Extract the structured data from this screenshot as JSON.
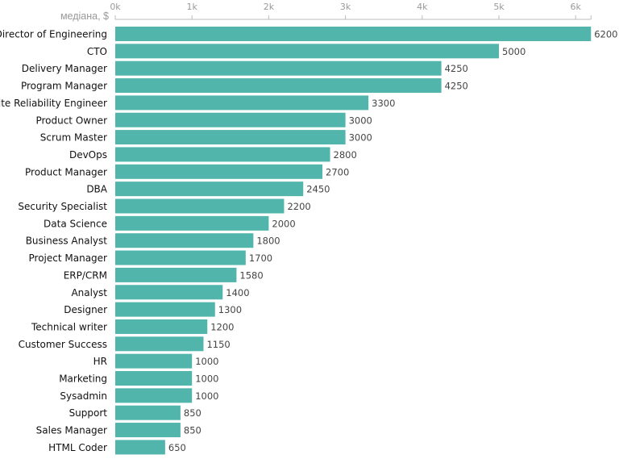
{
  "chart_data": {
    "type": "bar",
    "orientation": "horizontal",
    "title": "",
    "xlabel": "медіана, $",
    "ylabel": "",
    "xlim": [
      0,
      6200
    ],
    "x_ticks": [
      0,
      1000,
      2000,
      3000,
      4000,
      5000,
      6000
    ],
    "x_tick_labels": [
      "0k",
      "1k",
      "2k",
      "3k",
      "4k",
      "5k",
      "6k"
    ],
    "axis_position": "top",
    "grid": false,
    "bar_color": "#52b5ac",
    "categories": [
      "Director of Engineering",
      "CTO",
      "Delivery Manager",
      "Program Manager",
      "Site Reliability Engineer",
      "Product Owner",
      "Scrum Master",
      "DevOps",
      "Product Manager",
      "DBA",
      "Security Specialist",
      "Data Science",
      "Business Analyst",
      "Project Manager",
      "ERP/CRM",
      "Analyst",
      "Designer",
      "Technical writer",
      "Customer Success",
      "HR",
      "Marketing",
      "Sysadmin",
      "Support",
      "Sales Manager",
      "HTML Coder"
    ],
    "values": [
      6200,
      5000,
      4250,
      4250,
      3300,
      3000,
      3000,
      2800,
      2700,
      2450,
      2200,
      2000,
      1800,
      1700,
      1580,
      1400,
      1300,
      1200,
      1150,
      1000,
      1000,
      1000,
      850,
      850,
      650
    ]
  }
}
